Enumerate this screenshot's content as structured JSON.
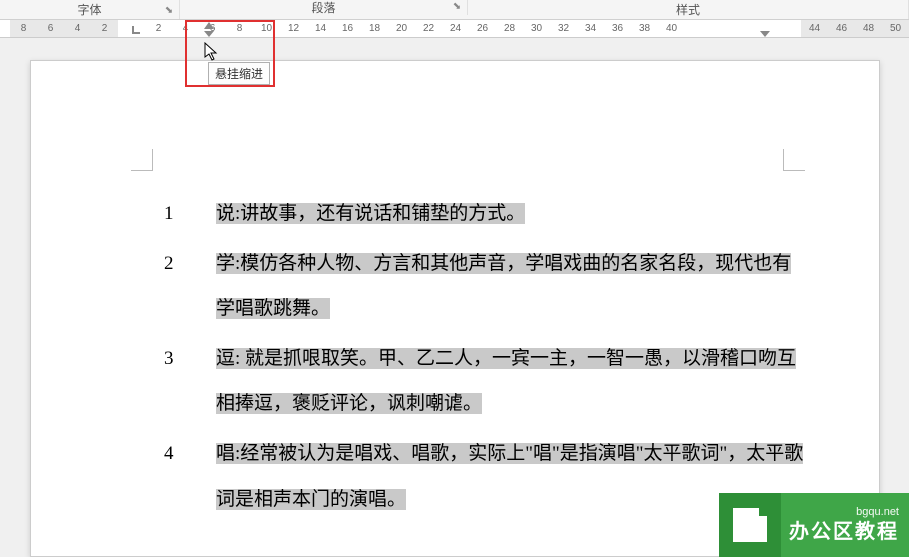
{
  "ribbon": {
    "font_label": "字体",
    "paragraph_label": "段落",
    "style_label": "样式"
  },
  "ruler": {
    "ticks_left": [
      "8",
      "6",
      "4",
      "2"
    ],
    "ticks_mid": [
      "2",
      "4",
      "6",
      "8",
      "10",
      "12",
      "14",
      "16",
      "18",
      "20",
      "22",
      "24",
      "26",
      "28",
      "30",
      "32",
      "34",
      "36",
      "38",
      "40"
    ],
    "ticks_right": [
      "44",
      "46",
      "48",
      "50"
    ]
  },
  "tooltip": {
    "hanging_indent": "悬挂缩进"
  },
  "document": {
    "items": [
      {
        "num": "1",
        "text": "说:讲故事，还有说话和铺垫的方式。"
      },
      {
        "num": "2",
        "text": "学:模仿各种人物、方言和其他声音，学唱戏曲的名家名段，现代也有学唱歌跳舞。"
      },
      {
        "num": "3",
        "text": "逗: 就是抓哏取笑。甲、乙二人，一宾一主，一智一愚，以滑稽口吻互相捧逗，褒贬评论，讽刺嘲谑。"
      },
      {
        "num": "4",
        "text": "唱:经常被认为是唱戏、唱歌，实际上\"唱\"是指演唱\"太平歌词\"，太平歌词是相声本门的演唱。"
      }
    ]
  },
  "watermark": {
    "url": "bgqu.net",
    "title": "办公区教程"
  }
}
